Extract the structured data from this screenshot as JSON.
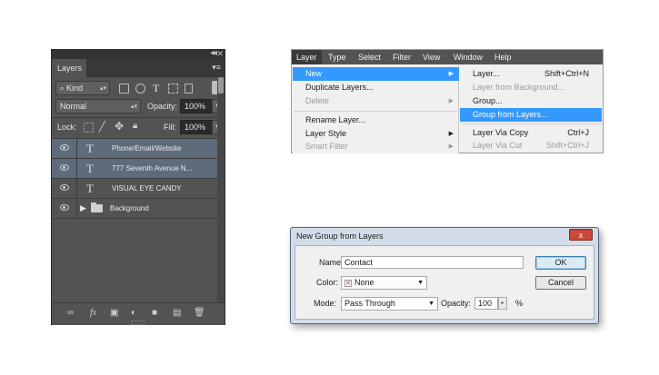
{
  "layers_panel": {
    "tab": "Layers",
    "filter_kind": "Kind",
    "blend_mode": "Normal",
    "opacity_label": "Opacity:",
    "opacity_value": "100%",
    "lock_label": "Lock:",
    "fill_label": "Fill:",
    "fill_value": "100%",
    "layers": [
      {
        "name": "Phone/Email/Website",
        "type": "text",
        "selected": true
      },
      {
        "name": "777 Seventh Avenue N...",
        "type": "text",
        "selected": true
      },
      {
        "name": "VISUAL EYE CANDY",
        "type": "text",
        "selected": false
      },
      {
        "name": "Background",
        "type": "group",
        "selected": false
      }
    ],
    "text_glyph": "T"
  },
  "menu": {
    "bar": [
      "Layer",
      "Type",
      "Select",
      "Filter",
      "View",
      "Window",
      "Help"
    ],
    "active": "Layer",
    "submenu": [
      {
        "label": "New",
        "highlighted": true,
        "arrow": true
      },
      {
        "label": "Duplicate Layers...",
        "disabled": false
      },
      {
        "label": "Delete",
        "disabled": true,
        "arrow": true
      },
      {
        "label": "Rename Layer...",
        "disabled": false
      },
      {
        "label": "Layer Style",
        "disabled": false,
        "arrow": true
      },
      {
        "label": "Smart Filter",
        "disabled": true,
        "arrow": true
      }
    ],
    "new_submenu": [
      {
        "label": "Layer...",
        "shortcut": "Shift+Ctrl+N"
      },
      {
        "label": "Layer from Background...",
        "disabled": true
      },
      {
        "label": "Group...",
        "disabled": false
      },
      {
        "label": "Group from Layers...",
        "highlighted": true
      },
      {
        "label": "Layer Via Copy",
        "shortcut": "Ctrl+J"
      },
      {
        "label": "Layer Via Cut",
        "shortcut": "Shift+Ctrl+J",
        "disabled": true
      }
    ]
  },
  "dialog": {
    "title": "New Group from Layers",
    "close": "x",
    "name_label": "Name:",
    "name_value": "Contact",
    "color_label": "Color:",
    "color_value": "None",
    "mode_label": "Mode:",
    "mode_value": "Pass Through",
    "opacity_label": "Opacity:",
    "opacity_value": "100",
    "percent": "%",
    "ok": "OK",
    "cancel": "Cancel"
  },
  "colors": {
    "panel_bg": "#535353",
    "selected_layer": "#5d6b7b",
    "menu_highlight": "#3399ff",
    "dialog_close": "#c9493a"
  }
}
